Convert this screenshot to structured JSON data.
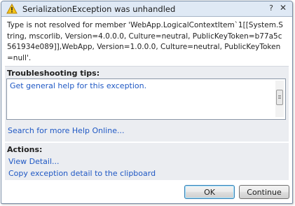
{
  "dialog": {
    "title": "SerializationException was unhandled",
    "help_glyph": "?",
    "close_glyph": "✕",
    "title_icon": "warning-icon",
    "message": "Type is not resolved for member 'WebApp.LogicalContextItem`1[[System.String, mscorlib, Version=4.0.0.0, Culture=neutral, PublicKeyToken=b77a5c561934e089]],WebApp, Version=1.0.0.0, Culture=neutral, PublicKeyToken=null'."
  },
  "tips": {
    "heading": "Troubleshooting tips:",
    "items": [
      "Get general help for this exception."
    ],
    "search_link": "Search for more Help Online..."
  },
  "actions": {
    "heading": "Actions:",
    "items": [
      "View Detail...",
      "Copy exception detail to the clipboard"
    ]
  },
  "buttons": {
    "ok_label": "OK",
    "continue_label": "Continue"
  },
  "colors": {
    "link": "#1f58c4",
    "panel": "#ebedf1",
    "titlebar": "#dfe9f5",
    "warning": "#f5c518"
  }
}
